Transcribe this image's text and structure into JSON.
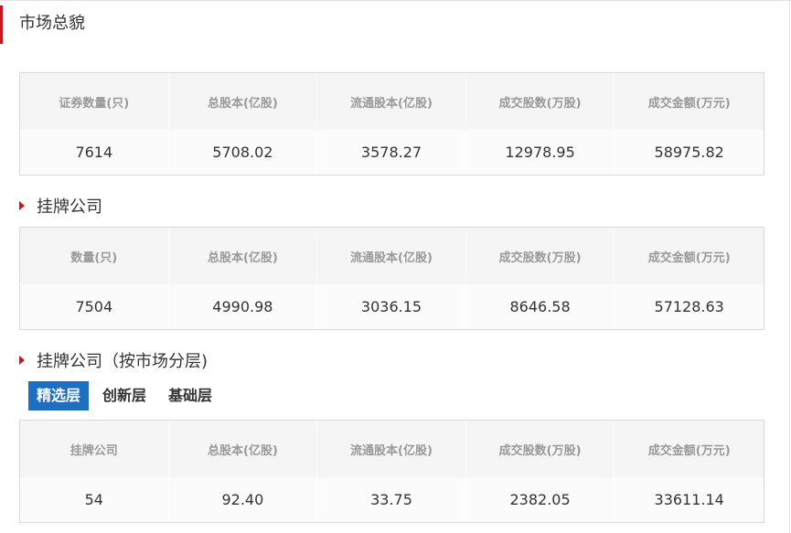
{
  "market_overview": {
    "title": "市场总貌",
    "headers": [
      "证券数量(只)",
      "总股本(亿股)",
      "流通股本(亿股)",
      "成交股数(万股)",
      "成交金额(万元)"
    ],
    "values": [
      "7614",
      "5708.02",
      "3578.27",
      "12978.95",
      "58975.82"
    ]
  },
  "listed_companies": {
    "title": "挂牌公司",
    "headers": [
      "数量(只)",
      "总股本(亿股)",
      "流通股本(亿股)",
      "成交股数(万股)",
      "成交金额(万元)"
    ],
    "values": [
      "7504",
      "4990.98",
      "3036.15",
      "8646.58",
      "57128.63"
    ]
  },
  "layered": {
    "title": "挂牌公司（按市场分层)",
    "tabs": [
      {
        "label": "精选层",
        "active": true
      },
      {
        "label": "创新层",
        "active": false
      },
      {
        "label": "基础层",
        "active": false
      }
    ],
    "headers": [
      "挂牌公司",
      "总股本(亿股)",
      "流通股本(亿股)",
      "成交股数(万股)",
      "成交金额(万元)"
    ],
    "values": [
      "54",
      "92.40",
      "33.75",
      "2382.05",
      "33611.14"
    ]
  },
  "colors": {
    "accent_red": "#c8161e",
    "tab_active_bg": "#1e6fc0",
    "header_text": "#999999"
  }
}
